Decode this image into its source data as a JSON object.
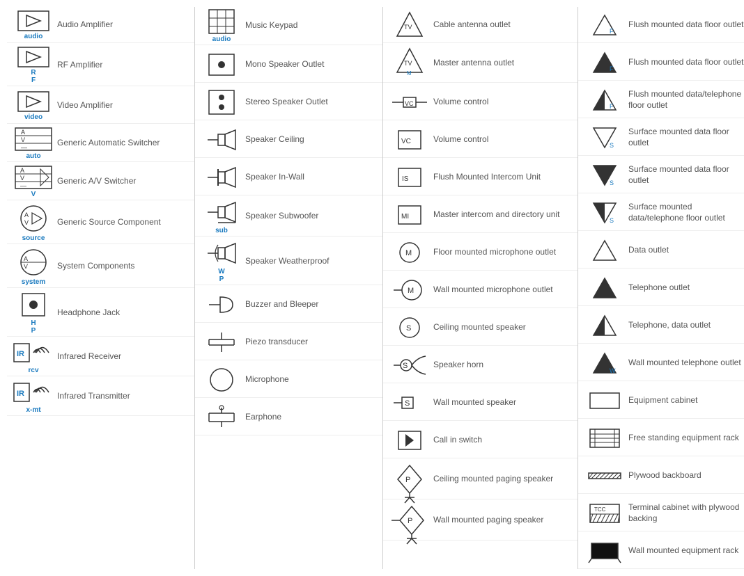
{
  "columns": [
    {
      "items": [
        {
          "symbol_type": "audio_amplifier",
          "label": "audio",
          "desc": "Audio Amplifier"
        },
        {
          "symbol_type": "rf_amplifier",
          "label": "RF",
          "desc": "RF Amplifier"
        },
        {
          "symbol_type": "video_amplifier",
          "label": "video",
          "desc": "Video Amplifier"
        },
        {
          "symbol_type": "generic_auto_switcher",
          "label": "auto",
          "desc": "Generic Automatic Switcher"
        },
        {
          "symbol_type": "generic_av_switcher",
          "label": "V",
          "desc": "Generic A/V Switcher"
        },
        {
          "symbol_type": "generic_source",
          "label": "source",
          "desc": "Generic Source Component"
        },
        {
          "symbol_type": "system_components",
          "label": "system",
          "desc": "System Components"
        },
        {
          "symbol_type": "headphone_jack",
          "label": "HP",
          "desc": "Headphone Jack"
        },
        {
          "symbol_type": "infrared_receiver",
          "label": "rcv",
          "desc": "Infrared Receiver"
        },
        {
          "symbol_type": "infrared_transmitter",
          "label": "x-mt",
          "desc": "Infrared Transmitter"
        }
      ]
    },
    {
      "items": [
        {
          "symbol_type": "music_keypad",
          "label": "audio",
          "desc": "Music Keypad"
        },
        {
          "symbol_type": "mono_speaker",
          "label": "",
          "desc": "Mono Speaker Outlet"
        },
        {
          "symbol_type": "stereo_speaker",
          "label": "",
          "desc": "Stereo Speaker Outlet"
        },
        {
          "symbol_type": "speaker_ceiling",
          "label": "",
          "desc": "Speaker Ceiling"
        },
        {
          "symbol_type": "speaker_inwall",
          "label": "",
          "desc": "Speaker In-Wall"
        },
        {
          "symbol_type": "speaker_subwoofer",
          "label": "sub",
          "desc": "Speaker Subwoofer"
        },
        {
          "symbol_type": "speaker_weatherproof",
          "label": "WP",
          "desc": "Speaker Weatherproof"
        },
        {
          "symbol_type": "buzzer_bleeper",
          "label": "",
          "desc": "Buzzer and Bleeper"
        },
        {
          "symbol_type": "piezo_transducer",
          "label": "",
          "desc": "Piezo transducer"
        },
        {
          "symbol_type": "microphone",
          "label": "",
          "desc": "Microphone"
        },
        {
          "symbol_type": "earphone",
          "label": "",
          "desc": "Earphone"
        }
      ]
    },
    {
      "items": [
        {
          "symbol_type": "cable_antenna",
          "label": "TV",
          "desc": "Cable antenna outlet"
        },
        {
          "symbol_type": "master_antenna",
          "label": "TV M",
          "desc": "Master antenna outlet"
        },
        {
          "symbol_type": "volume_control_line",
          "label": "VC",
          "desc": "Volume control"
        },
        {
          "symbol_type": "volume_control_box",
          "label": "VC",
          "desc": "Volume control"
        },
        {
          "symbol_type": "flush_intercom",
          "label": "IS",
          "desc": "Flush Mounted Intercom Unit"
        },
        {
          "symbol_type": "master_intercom",
          "label": "MI",
          "desc": "Master intercom and directory unit"
        },
        {
          "symbol_type": "floor_mic",
          "label": "M",
          "desc": "Floor mounted microphone outlet"
        },
        {
          "symbol_type": "wall_mic",
          "label": "M",
          "desc": "Wall mounted microphone outlet"
        },
        {
          "symbol_type": "ceiling_speaker_circle",
          "label": "S",
          "desc": "Ceiling mounted speaker"
        },
        {
          "symbol_type": "speaker_horn",
          "label": "S",
          "desc": "Speaker horn"
        },
        {
          "symbol_type": "wall_speaker",
          "label": "S",
          "desc": "Wall mounted speaker"
        },
        {
          "symbol_type": "call_in_switch",
          "label": "",
          "desc": "Call in switch"
        },
        {
          "symbol_type": "ceiling_paging",
          "label": "P",
          "desc": "Ceiling mounted paging speaker"
        },
        {
          "symbol_type": "wall_paging",
          "label": "P",
          "desc": "Wall mounted paging speaker"
        }
      ]
    },
    {
      "items": [
        {
          "symbol_type": "flush_data_floor_f",
          "label": "F",
          "desc": "Flush mounted data floor outlet"
        },
        {
          "symbol_type": "flush_data_floor_f2",
          "label": "F",
          "desc": "Flush mounted data floor outlet"
        },
        {
          "symbol_type": "flush_data_tel_floor",
          "label": "F",
          "desc": "Flush mounted data/telephone floor outlet"
        },
        {
          "symbol_type": "surface_data_floor_s",
          "label": "S",
          "desc": "Surface mounted data floor outlet"
        },
        {
          "symbol_type": "surface_data_floor_s2",
          "label": "S",
          "desc": "Surface mounted data floor outlet"
        },
        {
          "symbol_type": "surface_data_tel_floor",
          "label": "S",
          "desc": "Surface mounted data/telephone floor outlet"
        },
        {
          "symbol_type": "data_outlet",
          "label": "",
          "desc": "Data outlet"
        },
        {
          "symbol_type": "telephone_outlet",
          "label": "",
          "desc": "Telephone outlet"
        },
        {
          "symbol_type": "telephone_data_outlet",
          "label": "",
          "desc": "Telephone, data outlet"
        },
        {
          "symbol_type": "wall_tel_outlet",
          "label": "W",
          "desc": "Wall mounted telephone outlet"
        },
        {
          "symbol_type": "equipment_cabinet",
          "label": "",
          "desc": "Equipment cabinet"
        },
        {
          "symbol_type": "free_standing_rack",
          "label": "",
          "desc": "Free standing equipment rack"
        },
        {
          "symbol_type": "plywood_backboard",
          "label": "",
          "desc": "Plywood backboard"
        },
        {
          "symbol_type": "terminal_cabinet",
          "label": "TCC",
          "desc": "Terminal cabinet with plywood backing"
        },
        {
          "symbol_type": "wall_equipment_rack",
          "label": "",
          "desc": "Wall mounted equipment rack"
        }
      ]
    }
  ]
}
